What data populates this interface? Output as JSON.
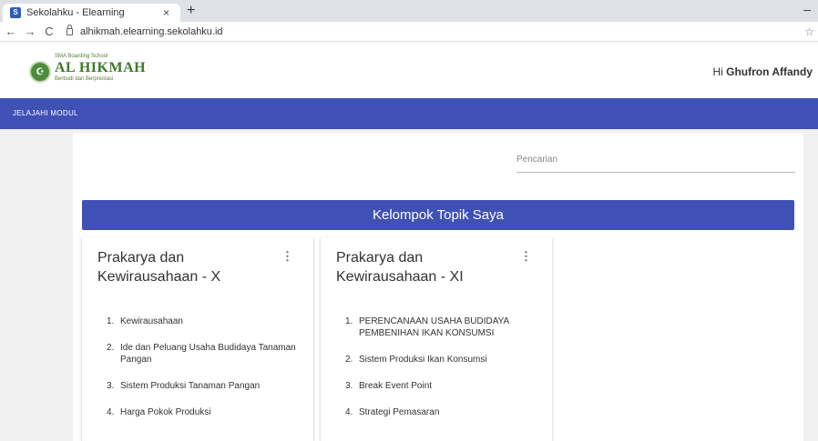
{
  "browser": {
    "tab_title": "Sekolahku - Elearning",
    "tab_close": "×",
    "new_tab": "+",
    "url": "alhikmah.elearning.sekolahku.id"
  },
  "header": {
    "logo_small": "SMA Boarding School",
    "logo_title": "AL HIKMAH",
    "logo_sub": "Berbudi dan Berprestasi",
    "greeting_prefix": "Hi",
    "user_name": "Ghufron Affandy"
  },
  "navbar": {
    "link": "JELAJAHI MODUL"
  },
  "search": {
    "placeholder": "Pencarian"
  },
  "group": {
    "title": "Kelompok Topik Saya"
  },
  "cards": [
    {
      "title": "Prakarya dan Kewirausahaan - X",
      "topics": [
        {
          "num": "1.",
          "label": "Kewirausahaan"
        },
        {
          "num": "2.",
          "label": "Ide dan Peluang Usaha Budidaya Tanaman Pangan"
        },
        {
          "num": "3.",
          "label": "Sistem Produksi Tanaman Pangan"
        },
        {
          "num": "4.",
          "label": "Harga Pokok Produksi"
        }
      ]
    },
    {
      "title": "Prakarya dan Kewirausahaan - XI",
      "topics": [
        {
          "num": "1.",
          "label": "PERENCANAAN USAHA BUDIDAYA PEMBENIHAN IKAN KONSUMSI"
        },
        {
          "num": "2.",
          "label": "Sistem Produksi Ikan Konsumsi"
        },
        {
          "num": "3.",
          "label": "Break Event Point"
        },
        {
          "num": "4.",
          "label": "Strategi Pemasaran"
        }
      ]
    }
  ],
  "colors": {
    "primary": "#3f51b5",
    "logo_green": "#3e7a2c"
  }
}
